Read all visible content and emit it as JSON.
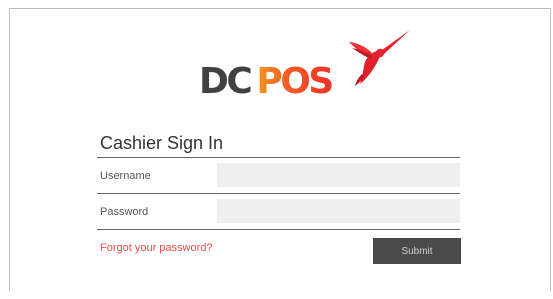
{
  "logo": {
    "part1": "DC",
    "part2": "POS",
    "icon": "hummingbird-icon"
  },
  "form": {
    "title": "Cashier Sign In",
    "username_label": "Username",
    "username_value": "",
    "password_label": "Password",
    "password_value": "",
    "forgot_link": "Forgot your password?",
    "submit_label": "Submit"
  },
  "colors": {
    "brand_dark": "#414042",
    "brand_orange": "#f05a28",
    "bird_red": "#e8222e",
    "link": "#ef4b4b",
    "button": "#4a4a4a",
    "field_bg": "#efefef"
  }
}
